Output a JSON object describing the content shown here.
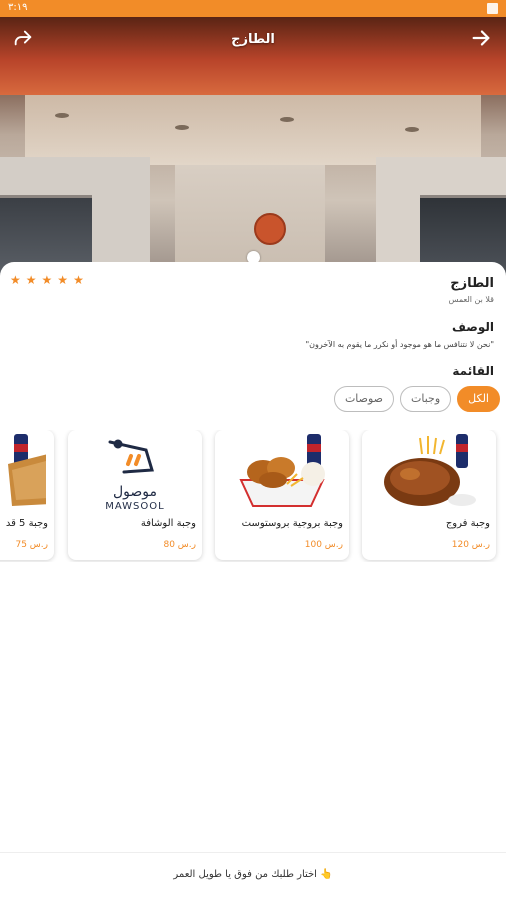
{
  "status_bar": {
    "time": "٣:١٩"
  },
  "header": {
    "title": "الطازج",
    "share_icon": "share-icon",
    "back_icon": "arrow-right-icon"
  },
  "restaurant": {
    "name": "الطازج",
    "location": "قلا بن العمس",
    "rating_stars": 5,
    "accent_color": "#f28c28"
  },
  "description": {
    "title": "الوصف",
    "text": "\"نحن لا نتنافس ما هو موجود أو نكرر ما يقوم به الآخرون\""
  },
  "menu": {
    "title": "القائمة",
    "tabs": [
      {
        "label": "الكل",
        "active": true
      },
      {
        "label": "وجبات",
        "active": false
      },
      {
        "label": "صوصات",
        "active": false
      }
    ],
    "items": [
      {
        "name": "وجبة فروج",
        "price": "120 ر.س"
      },
      {
        "name": "وجبة بروجية بروستوست",
        "price": "100 ر.س"
      },
      {
        "name": "وجبة الوشافة",
        "price": "80 ر.س"
      },
      {
        "name": "وجبة 5 قد",
        "price": "75 ر.س"
      }
    ],
    "logo_text": {
      "arabic": "موصول",
      "latin": "MAWSOOL"
    }
  },
  "bottom": {
    "hint": "اختار طلبك من فوق يا طويل العمر 👆"
  }
}
